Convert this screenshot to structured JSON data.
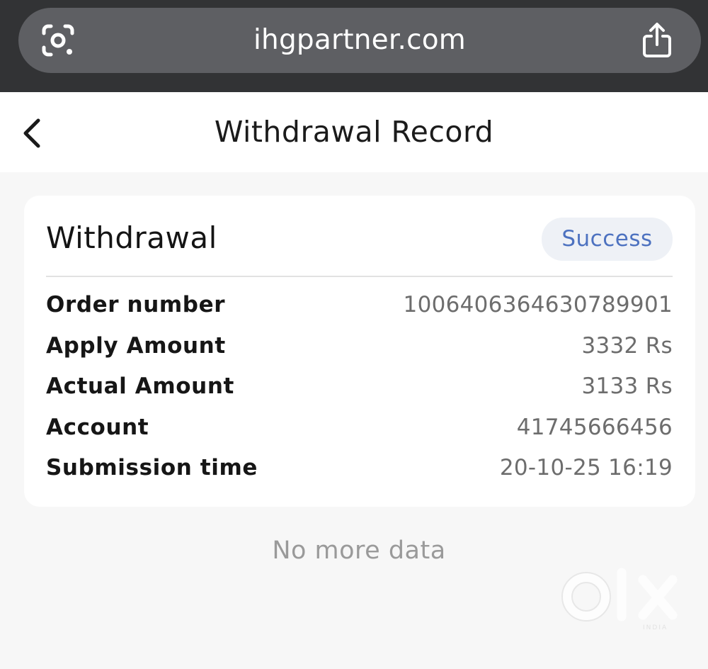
{
  "browser": {
    "url": "ihgpartner.com",
    "lens_icon": "google-lens-icon",
    "share_icon": "share-icon"
  },
  "header": {
    "title": "Withdrawal Record",
    "back_icon": "chevron-left-icon"
  },
  "record": {
    "title": "Withdrawal",
    "status": "Success",
    "fields": [
      {
        "label": "Order number",
        "value": "1006406364630789901"
      },
      {
        "label": "Apply Amount",
        "value": "3332 Rs"
      },
      {
        "label": "Actual Amount",
        "value": "3133 Rs"
      },
      {
        "label": "Account",
        "value": "41745666456"
      },
      {
        "label": "Submission time",
        "value": "20-10-25 16:19"
      }
    ]
  },
  "footer": {
    "no_more": "No more data"
  },
  "watermark": {
    "brand": "OLX",
    "region": "INDIA"
  },
  "colors": {
    "status_text": "#4d72c0",
    "status_bg": "#eef1f6",
    "page_bg": "#f7f7f7",
    "browser_bg": "#323335"
  }
}
